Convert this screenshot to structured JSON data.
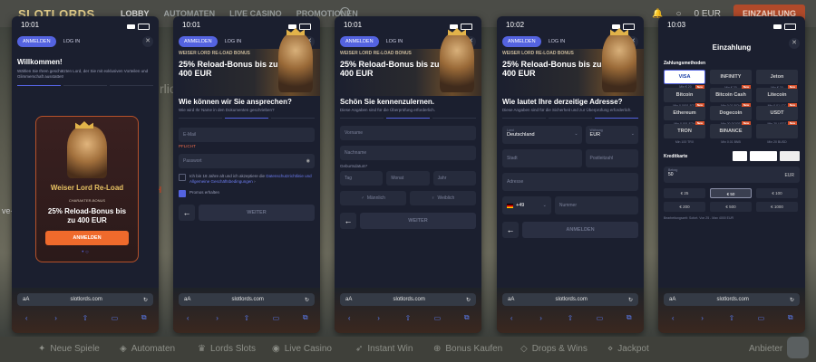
{
  "site": {
    "logo": "SLOTLORDS",
    "nav": [
      "LOBBY",
      "AUTOMATEN",
      "LIVE CASINO",
      "PROMOTIONEN"
    ],
    "balance": "0 EUR",
    "register": "EINZAHLUNG",
    "bottom_nav": [
      "Neue Spiele",
      "Automaten",
      "Lords Slots",
      "Live Casino",
      "Instant Win",
      "Bonus Kaufen",
      "Drops & Wins",
      "Jackpot",
      "Anbieter"
    ],
    "left_hint": "ve-",
    "bg_hint": "rlic",
    "bg_hint2": "H"
  },
  "browser": {
    "aa": "aA",
    "url": "slotlords.com",
    "reload": "↻"
  },
  "tabs": {
    "register": "ANMELDEN",
    "login": "LOG IN"
  },
  "bonus": {
    "label": "WEISER LORD RE-LOAD BONUS",
    "title": "25% Reload-Bonus bis zu 400 EUR"
  },
  "phone1": {
    "time": "10:01",
    "welcome": "Willkommen!",
    "text": "Wählen Sie Ihren geschätzten Lord, der Sie mit exklusiven Vorteilen und Glimmerschaft ausstattet!",
    "promo_title": "Weiser Lord Re-Load",
    "promo_code": "CHARAKTER-BONUS",
    "promo_bonus": "25% Reload-Bonus bis zu 400 EUR",
    "promo_button": "ANMELDEN",
    "dots": "• ○"
  },
  "phone2": {
    "time": "10:01",
    "question": "Wie können wir Sie ansprechen?",
    "sub": "Wie wird Ihr Name in den Dokumenten geschrieben?",
    "email": "E-Mail",
    "error": "PFLICHT",
    "password": "Passwort",
    "terms_pre": "Ich bin 18 Jahre alt und ich akzeptiere die",
    "terms_link": "Datenschutzrichtlinie und Allgemeine Geschäftsbedingungen",
    "terms_post": "›",
    "promos": "Promos erhalten",
    "next": "WEITER"
  },
  "phone3": {
    "time": "10:01",
    "question": "Schön Sie kennenzulernen.",
    "sub": "Diese Angaben sind für die Überprüfung erforderlich.",
    "firstname": "Vorname",
    "lastname": "Nachname",
    "dob": "Geburtsdatum*",
    "day": "Tag",
    "month": "Monat",
    "year": "Jahr",
    "male": "Männlich",
    "female": "Weiblich",
    "next": "WEITER"
  },
  "phone4": {
    "time": "10:02",
    "question": "Wie lautet Ihre derzeitige Adresse?",
    "sub": "Diese Angaben sind für die Sicherheit und zur Überprüfung erforderlich.",
    "country_label": "Land",
    "country": "Deutschland",
    "currency_label": "Währung",
    "currency": "EUR",
    "city": "Stadt",
    "zip": "Postleitzahl",
    "address": "Adresse",
    "prefix": "+49",
    "phone": "Nummer",
    "submit": "ANMELDEN"
  },
  "phone5": {
    "time": "10:03",
    "title": "Einzahlung",
    "methods_label": "Zahlungsmethoden",
    "methods": [
      {
        "name": "VISA",
        "lim": "Min € 20",
        "sel": true
      },
      {
        "name": "INFINITY",
        "lim": "Min € 20"
      },
      {
        "name": "Jeton",
        "lim": "Min € 20"
      },
      {
        "name": "Bitcoin",
        "lim": "Min 0.0001 BTC",
        "tag": "New"
      },
      {
        "name": "Bitcoin Cash",
        "lim": "Min 0.01 BCH",
        "tag": "New"
      },
      {
        "name": "Litecoin",
        "lim": "Min 0.01 LTC",
        "tag": "New"
      },
      {
        "name": "Ethereum",
        "lim": "Min 0.001 ETH",
        "tag": "New"
      },
      {
        "name": "Dogecoin",
        "lim": "Min 20 DOGE",
        "tag": "New"
      },
      {
        "name": "USDT",
        "lim": "Min 20 USDT",
        "tag": "New"
      },
      {
        "name": "TRON",
        "lim": "Min 100 TRX",
        "tag": "New"
      },
      {
        "name": "BINANCE",
        "lim": "Min 0.01 BNB",
        "tag": "New"
      },
      {
        "name": "",
        "lim": "Min 20 BUSD",
        "tag": "New"
      }
    ],
    "card_label": "Kreditkarte",
    "amount_label": "Betrag",
    "amount": "50",
    "amount_cur": "EUR",
    "chips": [
      "€ 25",
      "€ 50",
      "€ 100",
      "€ 200",
      "€ 500",
      "€ 1000"
    ],
    "footer": "Bearbeitungszeit: Sofort. Von 25 - Max 4000 EUR"
  }
}
